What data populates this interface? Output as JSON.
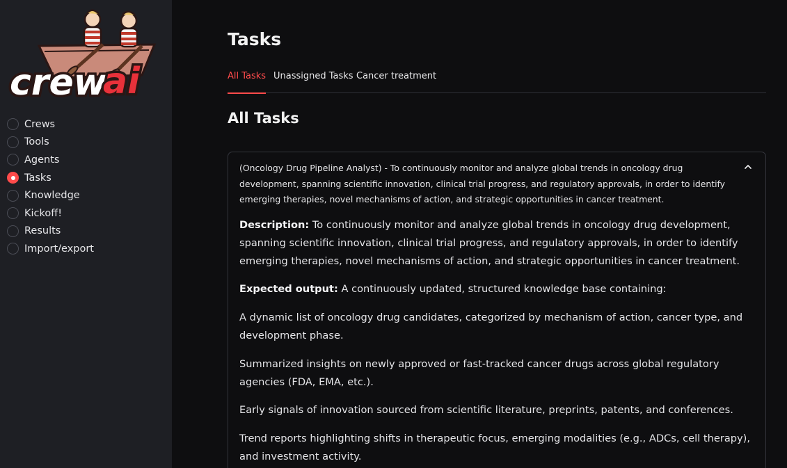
{
  "sidebar": {
    "logo_text": "crewai",
    "items": [
      {
        "label": "Crews",
        "selected": false
      },
      {
        "label": "Tools",
        "selected": false
      },
      {
        "label": "Agents",
        "selected": false
      },
      {
        "label": "Tasks",
        "selected": true
      },
      {
        "label": "Knowledge",
        "selected": false
      },
      {
        "label": "Kickoff!",
        "selected": false
      },
      {
        "label": "Results",
        "selected": false
      },
      {
        "label": "Import/export",
        "selected": false
      }
    ]
  },
  "main": {
    "title": "Tasks",
    "tabs": [
      {
        "label": "All Tasks",
        "active": true
      },
      {
        "label": "Unassigned Tasks",
        "active": false
      },
      {
        "label": "Cancer treatment",
        "active": false
      }
    ],
    "section_title": "All Tasks",
    "task": {
      "header": "(Oncology Drug Pipeline Analyst) - To continuously monitor and analyze global trends in oncology drug development, spanning scientific innovation, clinical trial progress, and regulatory approvals, in order to identify emerging therapies, novel mechanisms of action, and strategic opportunities in cancer treatment.",
      "description_label": "Description:",
      "description": "To continuously monitor and analyze global trends in oncology drug development, spanning scientific innovation, clinical trial progress, and regulatory approvals, in order to identify emerging therapies, novel mechanisms of action, and strategic opportunities in cancer treatment.",
      "expected_label": "Expected output:",
      "expected": "A continuously updated, structured knowledge base containing:",
      "outputs": [
        "A dynamic list of oncology drug candidates, categorized by mechanism of action, cancer type, and development phase.",
        "Summarized insights on newly approved or fast-tracked cancer drugs across global regulatory agencies (FDA, EMA, etc.).",
        "Early signals of innovation sourced from scientific literature, preprints, patents, and conferences.",
        "Trend reports highlighting shifts in therapeutic focus, emerging modalities (e.g., ADCs, cell therapy), and investment activity."
      ]
    }
  },
  "colors": {
    "accent": "#ff4b4b",
    "sidebar_bg": "#1e1f24",
    "main_bg": "#0e0e10"
  }
}
